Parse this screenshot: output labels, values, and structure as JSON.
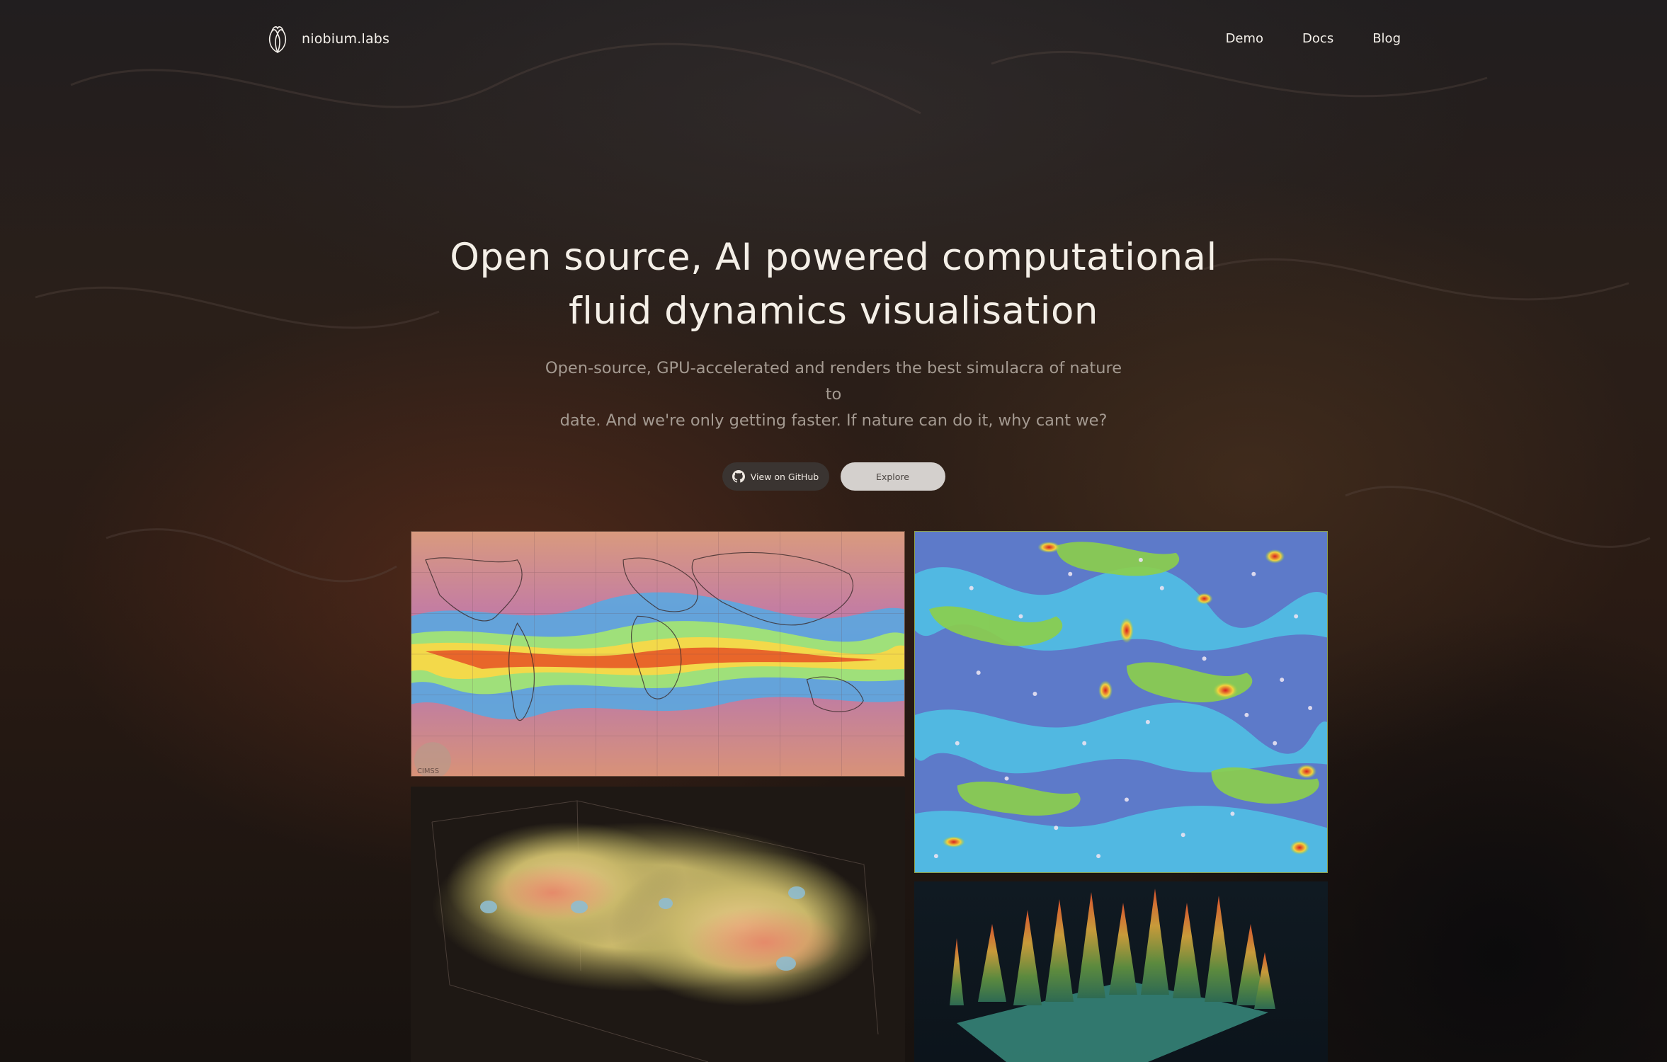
{
  "brand": {
    "name": "niobium.labs",
    "logo_icon": "fluid-drop-logo-icon"
  },
  "nav": {
    "items": [
      "Demo",
      "Docs",
      "Blog"
    ]
  },
  "hero": {
    "title_line1": "Open source, AI powered computational",
    "title_line2": "fluid dynamics visualisation",
    "subtitle_line1": "Open-source, GPU-accelerated and renders the best simulacra of nature to",
    "subtitle_line2": "date. And we're only getting faster. If nature can do it, why cant we?"
  },
  "buttons": {
    "github_label": "View on GitHub",
    "github_icon": "github-icon",
    "explore_label": "Explore"
  },
  "gallery": {
    "map": {
      "caption": "CIMSS"
    },
    "turbulence": {},
    "volume": {},
    "forest": {}
  },
  "colors": {
    "background": "#15110f",
    "text": "#f1ece4",
    "muted": "#a49a91",
    "github_button": "#3a3431",
    "explore_button": "#d4d0cd"
  }
}
